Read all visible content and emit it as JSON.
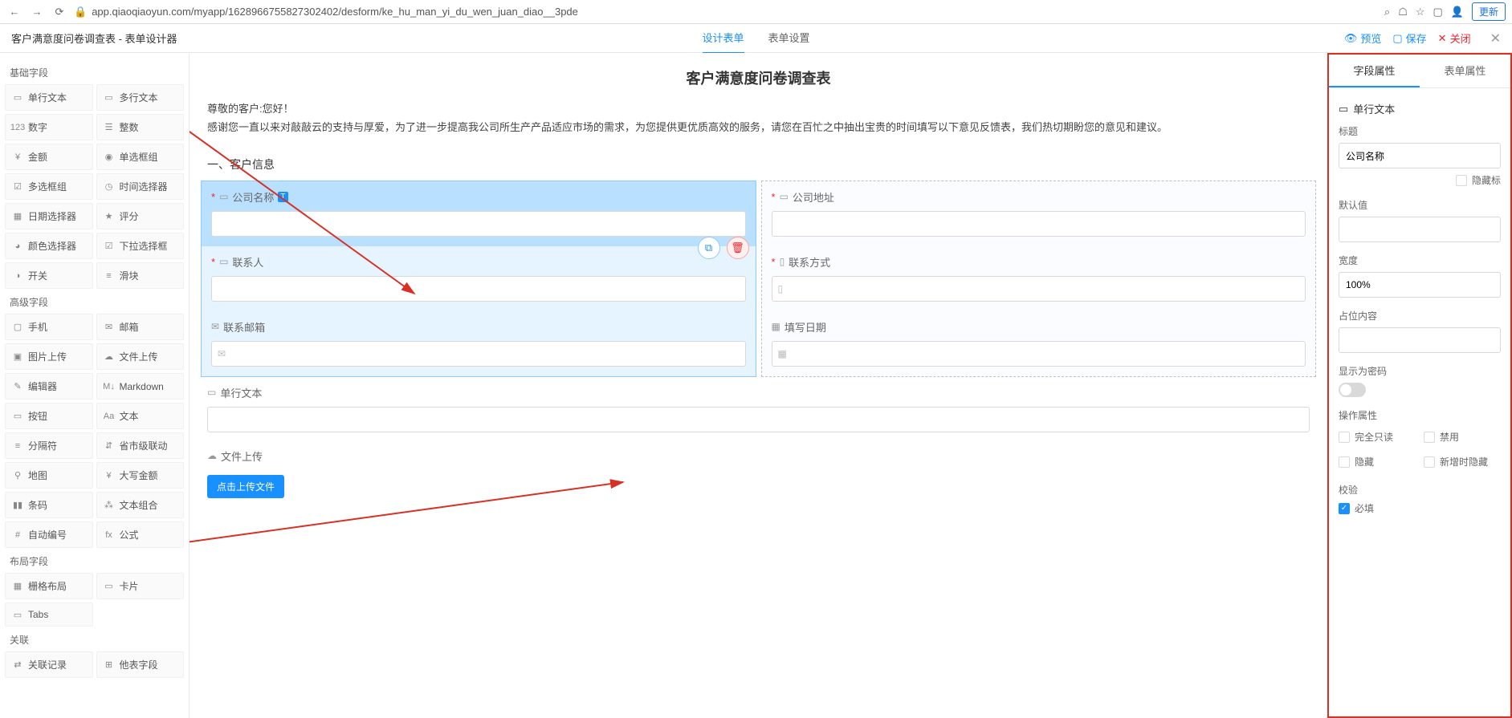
{
  "browser": {
    "url": "app.qiaoqiaoyun.com/myapp/1628966755827302402/desform/ke_hu_man_yi_du_wen_juan_diao__3pde",
    "update_btn": "更新"
  },
  "header": {
    "title": "客户满意度问卷调查表 - 表单设计器",
    "tabs": {
      "design": "设计表单",
      "settings": "表单设置"
    },
    "actions": {
      "preview": "预览",
      "save": "保存",
      "close": "关闭"
    }
  },
  "palette": {
    "basic_title": "基础字段",
    "basic": [
      {
        "icon": "▭",
        "label": "单行文本"
      },
      {
        "icon": "▭",
        "label": "多行文本"
      },
      {
        "icon": "123",
        "label": "数字"
      },
      {
        "icon": "☰",
        "label": "整数"
      },
      {
        "icon": "¥",
        "label": "金额"
      },
      {
        "icon": "◉",
        "label": "单选框组"
      },
      {
        "icon": "☑",
        "label": "多选框组"
      },
      {
        "icon": "◷",
        "label": "时间选择器"
      },
      {
        "icon": "▦",
        "label": "日期选择器"
      },
      {
        "icon": "★",
        "label": "评分"
      },
      {
        "icon": "◕",
        "label": "颜色选择器"
      },
      {
        "icon": "☑",
        "label": "下拉选择框"
      },
      {
        "icon": "◑",
        "label": "开关"
      },
      {
        "icon": "≡",
        "label": "滑块"
      }
    ],
    "advanced_title": "高级字段",
    "advanced": [
      {
        "icon": "▢",
        "label": "手机"
      },
      {
        "icon": "✉",
        "label": "邮箱"
      },
      {
        "icon": "▣",
        "label": "图片上传"
      },
      {
        "icon": "☁",
        "label": "文件上传"
      },
      {
        "icon": "✎",
        "label": "编辑器"
      },
      {
        "icon": "M↓",
        "label": "Markdown"
      },
      {
        "icon": "▭",
        "label": "按钮"
      },
      {
        "icon": "Aa",
        "label": "文本"
      },
      {
        "icon": "≡",
        "label": "分隔符"
      },
      {
        "icon": "⇵",
        "label": "省市级联动"
      },
      {
        "icon": "⚲",
        "label": "地图"
      },
      {
        "icon": "¥",
        "label": "大写金额"
      },
      {
        "icon": "▮▮",
        "label": "条码"
      },
      {
        "icon": "⁂",
        "label": "文本组合"
      },
      {
        "icon": "#",
        "label": "自动编号"
      },
      {
        "icon": "fx",
        "label": "公式"
      }
    ],
    "layout_title": "布局字段",
    "layout": [
      {
        "icon": "▦",
        "label": "栅格布局"
      },
      {
        "icon": "▭",
        "label": "卡片"
      },
      {
        "icon": "▭",
        "label": "Tabs"
      }
    ],
    "relation_title": "关联",
    "relation": [
      {
        "icon": "⇄",
        "label": "关联记录"
      },
      {
        "icon": "⊞",
        "label": "他表字段"
      }
    ]
  },
  "form": {
    "title": "客户满意度问卷调查表",
    "intro_greeting": "尊敬的客户:您好！",
    "intro_body": "感谢您一直以来对敲敲云的支持与厚爱，为了进一步提高我公司所生产产品适应市场的需求，为您提供更优质高效的服务，请您在百忙之中抽出宝贵的时间填写以下意见反馈表，我们热切期盼您的意见和建议。",
    "section1": "一、客户信息",
    "fields": {
      "company_name": "公司名称",
      "company_address": "公司地址",
      "contact_person": "联系人",
      "contact_method": "联系方式",
      "contact_email": "联系邮箱",
      "fill_date": "填写日期",
      "single_text": "单行文本",
      "file_upload": "文件上传",
      "upload_btn": "点击上传文件"
    }
  },
  "props": {
    "tabs": {
      "field": "字段属性",
      "form": "表单属性"
    },
    "type_label": "单行文本",
    "title_label": "标题",
    "title_value": "公司名称",
    "hide_title": "隐藏标",
    "default_label": "默认值",
    "width_label": "宽度",
    "width_value": "100%",
    "placeholder_label": "占位内容",
    "show_pwd_label": "显示为密码",
    "operation_label": "操作属性",
    "readonly": "完全只读",
    "disabled": "禁用",
    "hidden": "隐藏",
    "hide_on_add": "新增时隐藏",
    "validation_label": "校验",
    "required": "必填"
  }
}
